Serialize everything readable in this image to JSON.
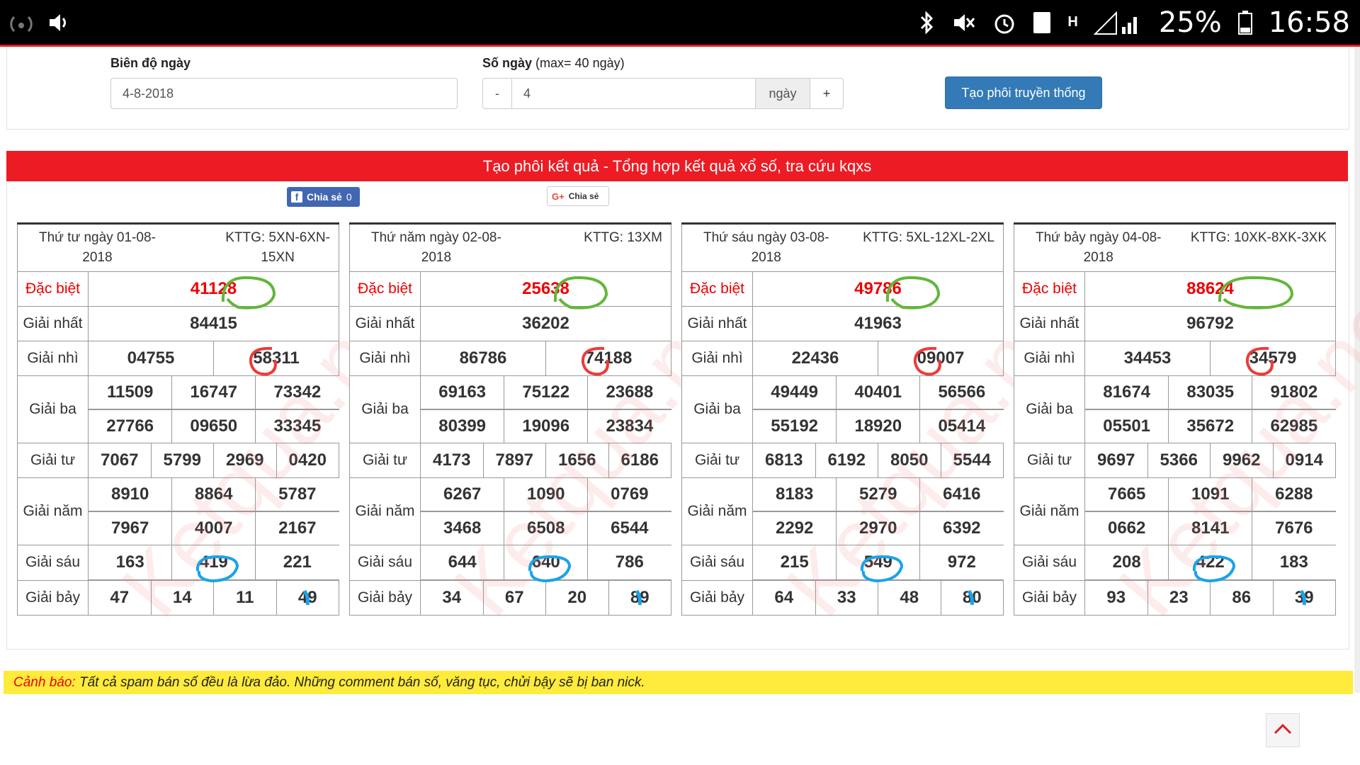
{
  "status": {
    "battery": "25%",
    "time": "16:58",
    "notif_count": "1",
    "net": "H"
  },
  "form": {
    "range_label": "Biên độ ngày",
    "range_value": "4-8-2018",
    "days_label": "Số ngày",
    "days_hint": "(max= 40 ngày)",
    "minus": "-",
    "days_value": "4",
    "days_unit": "ngày",
    "plus": "+",
    "button": "Tạo phôi truyền thống"
  },
  "header": "Tạo phôi kết quả - Tổng hợp kết quả xổ số, tra cứu kqxs",
  "share": {
    "fb_label": "Chia sẻ",
    "fb_count": "0",
    "g_label": "Chia sẻ"
  },
  "labels": {
    "db": "Đặc biệt",
    "g1": "Giải nhất",
    "g2": "Giải nhì",
    "g3": "Giải ba",
    "g4": "Giải tư",
    "g5": "Giải năm",
    "g6": "Giải sáu",
    "g7": "Giải bảy"
  },
  "watermark": "Ketqua.net",
  "days": [
    {
      "date1": "Thứ tư ngày 01-08-",
      "date2": "2018",
      "kttg1": "KTTG: 5XN-6XN-",
      "kttg2": "15XN",
      "db": "41128",
      "g1": "84415",
      "g2": [
        "04755",
        "58311"
      ],
      "g3": [
        "11509",
        "16747",
        "73342",
        "27766",
        "09650",
        "33345"
      ],
      "g4": [
        "7067",
        "5799",
        "2969",
        "0420"
      ],
      "g5": [
        "8910",
        "8864",
        "5787",
        "7967",
        "4007",
        "2167"
      ],
      "g6": [
        "163",
        "419",
        "221"
      ],
      "g7": [
        "47",
        "14",
        "11",
        "49"
      ]
    },
    {
      "date1": "Thứ năm ngày 02-08-",
      "date2": "2018",
      "kttg1": "KTTG: 13XM",
      "kttg2": "",
      "db": "25638",
      "g1": "36202",
      "g2": [
        "86786",
        "74188"
      ],
      "g3": [
        "69163",
        "75122",
        "23688",
        "80399",
        "19096",
        "23834"
      ],
      "g4": [
        "4173",
        "7897",
        "1656",
        "6186"
      ],
      "g5": [
        "6267",
        "1090",
        "0769",
        "3468",
        "6508",
        "6544"
      ],
      "g6": [
        "644",
        "640",
        "786"
      ],
      "g7": [
        "34",
        "67",
        "20",
        "89"
      ]
    },
    {
      "date1": "Thứ sáu ngày 03-08-",
      "date2": "2018",
      "kttg1": "KTTG: 5XL-12XL-2XL",
      "kttg2": "",
      "db": "49786",
      "g1": "41963",
      "g2": [
        "22436",
        "09007"
      ],
      "g3": [
        "49449",
        "40401",
        "56566",
        "55192",
        "18920",
        "05414"
      ],
      "g4": [
        "6813",
        "6192",
        "8050",
        "5544"
      ],
      "g5": [
        "8183",
        "5279",
        "6416",
        "2292",
        "2970",
        "6392"
      ],
      "g6": [
        "215",
        "549",
        "972"
      ],
      "g7": [
        "64",
        "33",
        "48",
        "80"
      ]
    },
    {
      "date1": "Thứ bảy ngày 04-08-",
      "date2": "2018",
      "kttg1": "KTTG: 10XK-8XK-3XK",
      "kttg2": "",
      "db": "88624",
      "g1": "96792",
      "g2": [
        "34453",
        "34579"
      ],
      "g3": [
        "81674",
        "83035",
        "91802",
        "05501",
        "35672",
        "62985"
      ],
      "g4": [
        "9697",
        "5366",
        "9962",
        "0914"
      ],
      "g5": [
        "7665",
        "1091",
        "6288",
        "0662",
        "8141",
        "7676"
      ],
      "g6": [
        "208",
        "422",
        "183"
      ],
      "g7": [
        "93",
        "23",
        "86",
        "39"
      ]
    }
  ],
  "warning": {
    "label": "Cảnh báo:",
    "text": " Tất cả spam bán số đều là lừa đảo. Những comment bán số, văng tục, chửi bậy sẽ bị ban nick."
  },
  "colors": {
    "brand_red": "#ed1c24",
    "button_blue": "#337ab7",
    "warning_yellow": "#ffeb3b"
  }
}
